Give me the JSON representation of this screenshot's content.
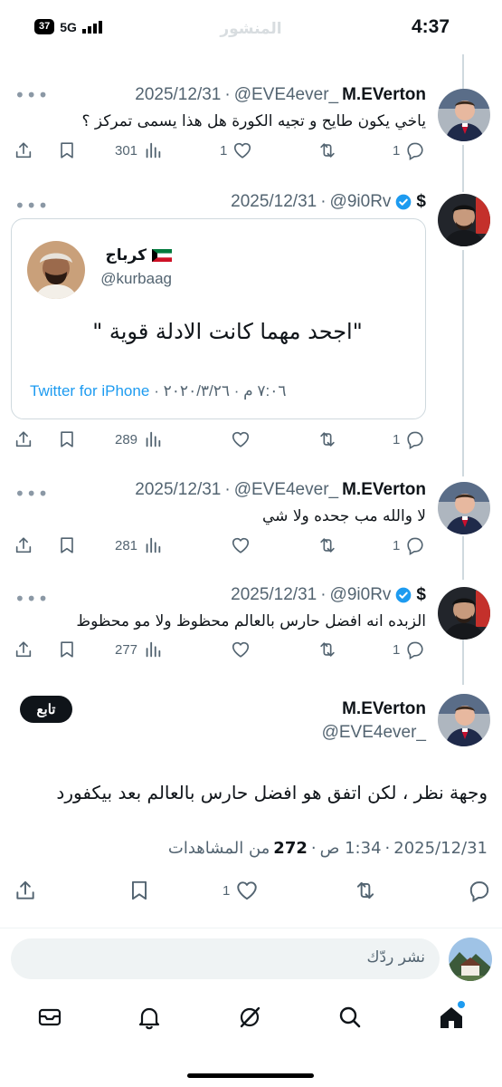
{
  "status_bar": {
    "time": "4:37",
    "battery": "37",
    "network": "5G"
  },
  "header": {
    "title": "المنشور"
  },
  "tweets": [
    {
      "name": "M.EVerton",
      "handle": "@EVE4ever_",
      "date": "2025/12/31",
      "text": "ياخي يكون طايح و تجيه الكورة هل هذا يسمى تمركز ؟",
      "replies": "1",
      "likes": "1",
      "views": "301"
    },
    {
      "name": "$",
      "handle": "@9i0Rv",
      "date": "2025/12/31",
      "text": "",
      "replies": "1",
      "likes": "",
      "views": "289",
      "verified": true
    },
    {
      "name": "M.EVerton",
      "handle": "@EVE4ever_",
      "date": "2025/12/31",
      "text": "لا والله مب جحده ولا شي",
      "replies": "1",
      "likes": "",
      "views": "281"
    },
    {
      "name": "$",
      "handle": "@9i0Rv",
      "date": "2025/12/31",
      "text": "الزبده انه افضل حارس بالعالم محظوظ ولا مو محظوظ",
      "replies": "1",
      "likes": "",
      "views": "277",
      "verified": true
    }
  ],
  "quote": {
    "name": "كرباج",
    "handle": "@kurbaag",
    "text": "\"اجحد مهما كانت الادلة قوية \"",
    "time": "٧:٠٦ م · ٢٠٢٠/٣/٢٦ ·",
    "source": "Twitter for iPhone"
  },
  "focus": {
    "name": "M.EVerton",
    "handle": "@EVE4ever_",
    "follow_label": "تابع",
    "text": "وجهة نظر ، لكن اتفق هو افضل حارس بالعالم بعد بيكفورد",
    "date": "2025/12/31",
    "time": "1:34 ص",
    "views_count": "272",
    "views_label": "من المشاهدات",
    "likes": "1"
  },
  "reply": {
    "placeholder": "نشر ردّك"
  },
  "colors": {
    "accent": "#1d9bf0",
    "text": "#0f1419",
    "muted": "#536471",
    "border": "#cfd9de"
  },
  "icons": [
    "reply-icon",
    "retweet-icon",
    "like-icon",
    "views-icon",
    "bookmark-icon",
    "share-icon",
    "more-icon",
    "verified-icon",
    "chevron-down-icon",
    "mail-icon",
    "bell-icon",
    "grok-icon",
    "search-icon",
    "home-icon"
  ]
}
